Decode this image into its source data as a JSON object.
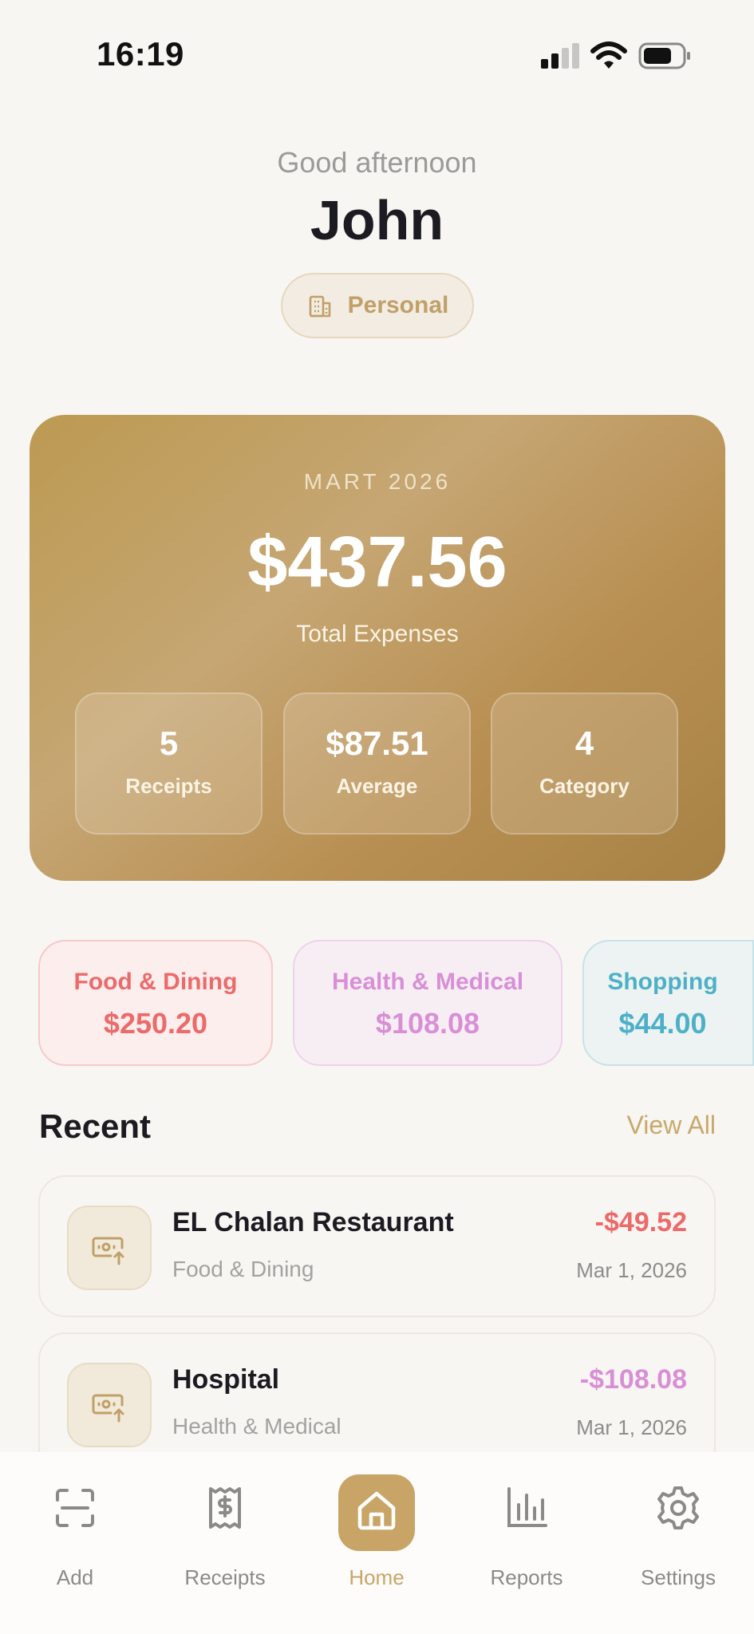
{
  "status_bar": {
    "time": "16:19",
    "icons": [
      "signal-icon",
      "wifi-icon",
      "battery-icon"
    ]
  },
  "greeting": {
    "text": "Good afternoon",
    "name": "John",
    "account_label": "Personal",
    "account_icon": "building-icon"
  },
  "summary": {
    "month": "MART 2026",
    "total": "$437.56",
    "total_label": "Total Expenses",
    "stats": [
      {
        "value": "5",
        "label": "Receipts"
      },
      {
        "value": "$87.51",
        "label": "Average"
      },
      {
        "value": "4",
        "label": "Category"
      }
    ]
  },
  "categories": [
    {
      "name": "Food & Dining",
      "amount": "$250.20",
      "color": "#ec6a6a"
    },
    {
      "name": "Health & Medical",
      "amount": "$108.08",
      "color": "#d98fd6"
    },
    {
      "name": "Shopping",
      "amount": "$44.00",
      "color": "#4eb0c8"
    }
  ],
  "recent": {
    "title": "Recent",
    "view_all": "View All",
    "items": [
      {
        "merchant": "EL Chalan Restaurant",
        "category": "Food & Dining",
        "amount": "-$49.52",
        "date": "Mar 1, 2026",
        "icon": "money-upload-icon",
        "color": "#ec6a6a"
      },
      {
        "merchant": "Hospital",
        "category": "Health & Medical",
        "amount": "-$108.08",
        "date": "Mar 1, 2026",
        "icon": "money-upload-icon",
        "color": "#d98fd6"
      }
    ]
  },
  "tabs": [
    {
      "label": "Add",
      "icon": "scan-icon"
    },
    {
      "label": "Receipts",
      "icon": "receipt-icon"
    },
    {
      "label": "Home",
      "icon": "home-icon",
      "active": true
    },
    {
      "label": "Reports",
      "icon": "bar-chart-icon"
    },
    {
      "label": "Settings",
      "icon": "gear-icon"
    }
  ],
  "colors": {
    "accent": "#c8a566",
    "background": "#f8f6f2"
  }
}
